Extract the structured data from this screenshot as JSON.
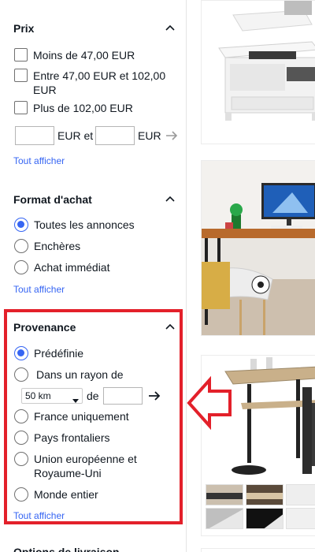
{
  "filters": {
    "price": {
      "title": "Prix",
      "options": [
        "Moins de 47,00 EUR",
        "Entre 47,00 EUR et 102,00 EUR",
        "Plus de 102,00 EUR"
      ],
      "range_unit_1": "EUR et",
      "range_unit_2": "EUR",
      "show_all": "Tout afficher"
    },
    "format": {
      "title": "Format d'achat",
      "options": [
        "Toutes les annonces",
        "Enchères",
        "Achat immédiat"
      ],
      "selected": "Toutes les annonces",
      "show_all": "Tout afficher"
    },
    "origin": {
      "title": "Provenance",
      "options": [
        "Prédéfinie",
        "Dans un rayon de",
        "France uniquement",
        "Pays frontaliers",
        "Union européenne et Royaume-Uni",
        "Monde entier"
      ],
      "selected": "Prédéfinie",
      "distance_value": "50 km",
      "distance_de": "de",
      "show_all": "Tout afficher"
    },
    "next_section_partial": "Options de livraison"
  },
  "colors": {
    "accent": "#3665f3",
    "highlight": "#e3202a"
  },
  "icons": {
    "collapse": "chevron-up-icon",
    "submit": "arrow-right-icon",
    "dropdown": "chevron-down-icon",
    "callout": "arrow-left-callout"
  }
}
